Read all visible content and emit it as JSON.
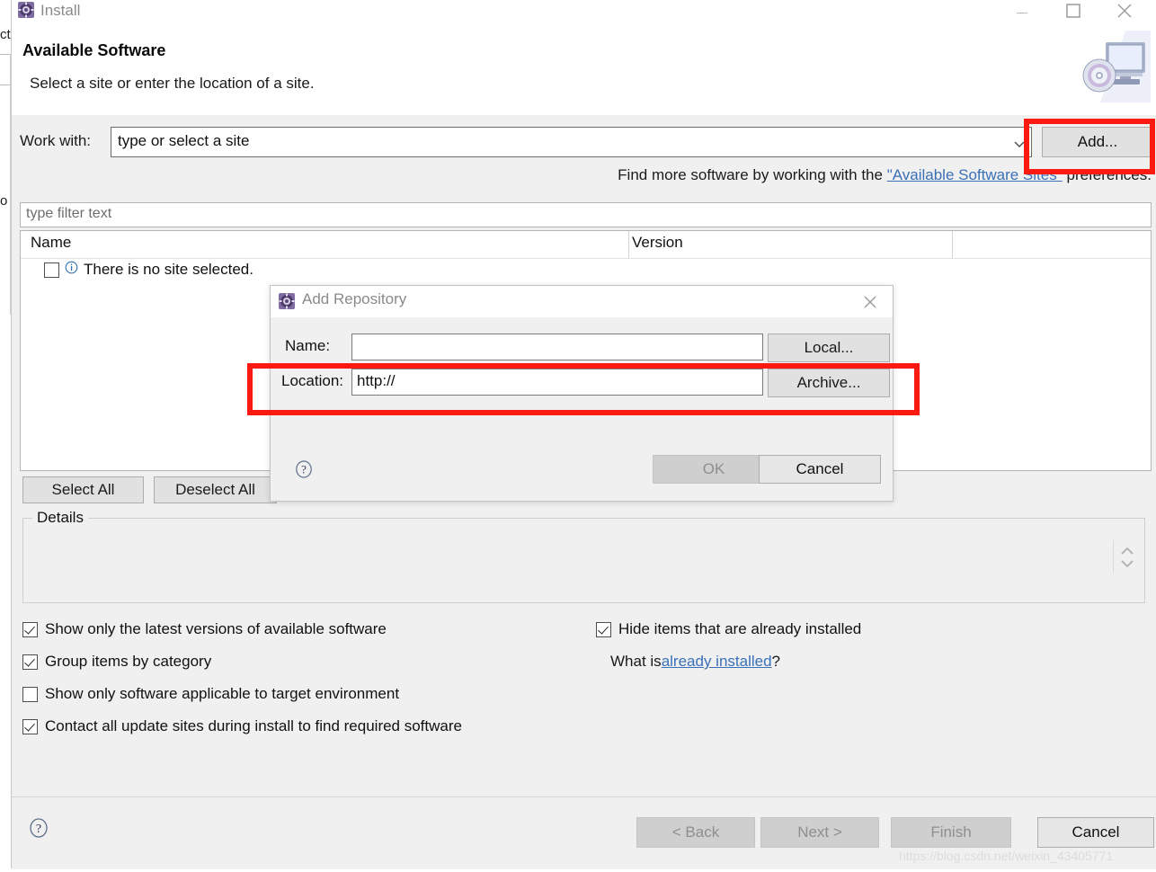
{
  "window": {
    "title": "Install",
    "icon": "install-gear-icon",
    "controls": {
      "minimize": "–",
      "maximize": "□",
      "close": "✕"
    }
  },
  "header": {
    "title": "Available Software",
    "subtitle": "Select a site or enter the location of a site.",
    "banner_icon": "monitor-cd-icon"
  },
  "work_with": {
    "label": "Work with:",
    "value": "type or select a site",
    "placeholder": "type or select a site",
    "add_button": "Add..."
  },
  "find_more": {
    "prefix": "Find more software by working with the ",
    "link": "\"Available Software Sites\"",
    "suffix": " preferences."
  },
  "filter": {
    "placeholder": "type filter text",
    "value": ""
  },
  "table": {
    "columns": [
      "Name",
      "Version"
    ],
    "rows": [
      {
        "checked": false,
        "icon": "info-icon",
        "label": "There is no site selected."
      }
    ]
  },
  "list_buttons": {
    "select_all": "Select All",
    "deselect_all": "Deselect All"
  },
  "details": {
    "legend": "Details",
    "content": "",
    "spinner_icon": "spinner-up-down-icon"
  },
  "options_left": [
    {
      "label": "Show only the latest versions of available software",
      "checked": true
    },
    {
      "label": "Group items by category",
      "checked": true
    },
    {
      "label": "Show only software applicable to target environment",
      "checked": false
    },
    {
      "label": "Contact all update sites during install to find required software",
      "checked": true
    }
  ],
  "options_right": [
    {
      "label": "Hide items that are already installed",
      "checked": true
    }
  ],
  "already_installed": {
    "prefix": "What is ",
    "link": "already installed",
    "suffix": "?"
  },
  "footer": {
    "help_icon": "help-question-icon",
    "buttons": [
      {
        "label": "< Back",
        "enabled": false
      },
      {
        "label": "Next >",
        "enabled": false
      },
      {
        "label": "Finish",
        "enabled": false
      },
      {
        "label": "Cancel",
        "enabled": true
      }
    ]
  },
  "watermark": "https://blog.csdn.net/weixin_43405771",
  "add_repository_dialog": {
    "title": "Add Repository",
    "icon": "install-gear-icon",
    "close": "✕",
    "name_label": "Name:",
    "name_value": "",
    "local_button": "Local...",
    "location_label": "Location:",
    "location_value": "http://",
    "archive_button": "Archive...",
    "help_icon": "help-question-icon",
    "ok_button": "OK",
    "ok_enabled": false,
    "cancel_button": "Cancel"
  },
  "highlights": {
    "color": "#fb1a10",
    "regions": [
      "add-button",
      "location-row"
    ]
  },
  "background_fragments": [
    "ct",
    "o"
  ]
}
